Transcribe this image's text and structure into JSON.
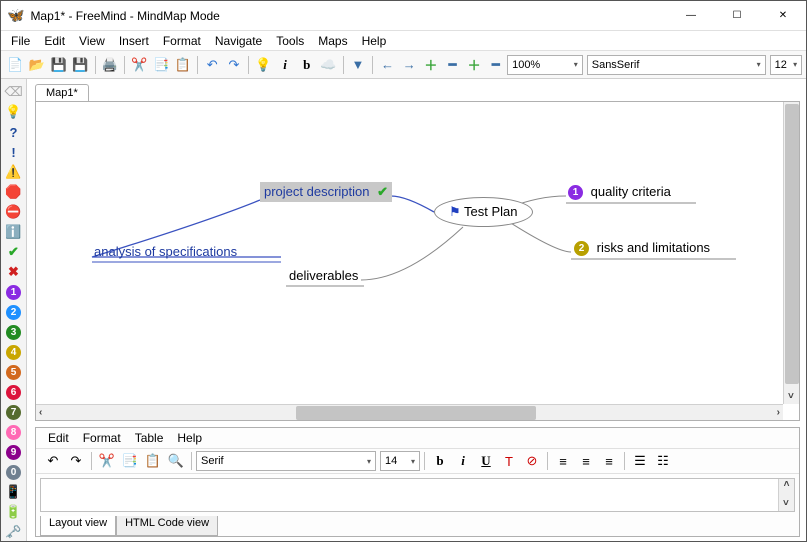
{
  "window": {
    "title": "Map1* - FreeMind - MindMap Mode"
  },
  "menu": [
    "File",
    "Edit",
    "View",
    "Insert",
    "Format",
    "Navigate",
    "Tools",
    "Maps",
    "Help"
  ],
  "toolbar": {
    "zoom": "100%",
    "font_family": "SansSerif",
    "font_size": "12"
  },
  "rail": {
    "numbers": [
      {
        "n": "1",
        "bg": "#8a2be2"
      },
      {
        "n": "2",
        "bg": "#1e90ff"
      },
      {
        "n": "3",
        "bg": "#228b22"
      },
      {
        "n": "4",
        "bg": "#d4b400"
      },
      {
        "n": "5",
        "bg": "#d2691e"
      },
      {
        "n": "6",
        "bg": "#dc143c"
      },
      {
        "n": "7",
        "bg": "#556b2f"
      },
      {
        "n": "8",
        "bg": "#ff69b4"
      },
      {
        "n": "9",
        "bg": "#8b008b"
      },
      {
        "n": "0",
        "bg": "#708090"
      }
    ]
  },
  "tabs": {
    "document_tab": "Map1*"
  },
  "mindmap": {
    "root": "Test Plan",
    "nodes": {
      "quality": "quality criteria",
      "risks": "risks and limitations",
      "deliverables": "deliverables",
      "project_desc": "project description",
      "analysis": "analysis of specifications"
    },
    "badges": {
      "quality_num": "1",
      "quality_color": "#8a2be2",
      "risks_num": "2",
      "risks_color": "#b8a000"
    }
  },
  "editor": {
    "menu": [
      "Edit",
      "Format",
      "Table",
      "Help"
    ],
    "font_family": "Serif",
    "font_size": "14",
    "tabs": {
      "layout": "Layout view",
      "html": "HTML Code view"
    }
  }
}
